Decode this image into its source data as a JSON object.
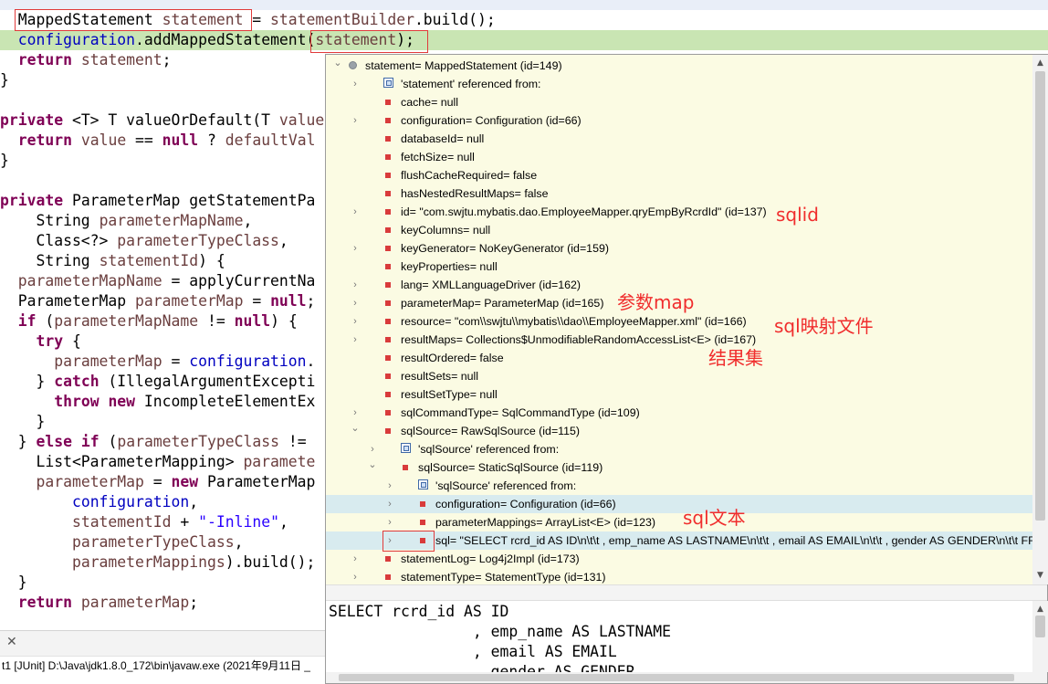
{
  "editor": {
    "lines": [
      [
        {
          "t": "  MappedStatement "
        },
        {
          "t": "statement",
          "c": "var"
        },
        {
          "t": " = "
        },
        {
          "t": "statementBuilder",
          "c": "var"
        },
        {
          "t": ".build();"
        }
      ],
      [
        {
          "t": "  "
        },
        {
          "t": "configuration",
          "c": "fld"
        },
        {
          "t": ".addMappedStatement("
        },
        {
          "t": "statement",
          "c": "var"
        },
        {
          "t": ");"
        }
      ],
      [
        {
          "t": "  "
        },
        {
          "t": "return",
          "c": "kw"
        },
        {
          "t": " "
        },
        {
          "t": "statement",
          "c": "var"
        },
        {
          "t": ";"
        }
      ],
      [
        {
          "t": "}"
        }
      ],
      [
        {
          "t": ""
        }
      ],
      [
        {
          "t": "private",
          "c": "kw"
        },
        {
          "t": " <T> T valueOrDefault(T "
        },
        {
          "t": "value",
          "c": "var"
        }
      ],
      [
        {
          "t": "  "
        },
        {
          "t": "return",
          "c": "kw"
        },
        {
          "t": " "
        },
        {
          "t": "value",
          "c": "var"
        },
        {
          "t": " == "
        },
        {
          "t": "null",
          "c": "kw"
        },
        {
          "t": " ? "
        },
        {
          "t": "defaultVal",
          "c": "var"
        }
      ],
      [
        {
          "t": "}"
        }
      ],
      [
        {
          "t": ""
        }
      ],
      [
        {
          "t": "private",
          "c": "kw"
        },
        {
          "t": " ParameterMap getStatementPa"
        }
      ],
      [
        {
          "t": "    String "
        },
        {
          "t": "parameterMapName",
          "c": "var"
        },
        {
          "t": ","
        }
      ],
      [
        {
          "t": "    Class<?> "
        },
        {
          "t": "parameterTypeClass",
          "c": "var"
        },
        {
          "t": ","
        }
      ],
      [
        {
          "t": "    String "
        },
        {
          "t": "statementId",
          "c": "var"
        },
        {
          "t": ") {"
        }
      ],
      [
        {
          "t": "  "
        },
        {
          "t": "parameterMapName",
          "c": "var"
        },
        {
          "t": " = applyCurrentNa"
        }
      ],
      [
        {
          "t": "  ParameterMap "
        },
        {
          "t": "parameterMap",
          "c": "var"
        },
        {
          "t": " = "
        },
        {
          "t": "null",
          "c": "kw"
        },
        {
          "t": ";"
        }
      ],
      [
        {
          "t": "  "
        },
        {
          "t": "if",
          "c": "kw"
        },
        {
          "t": " ("
        },
        {
          "t": "parameterMapName",
          "c": "var"
        },
        {
          "t": " != "
        },
        {
          "t": "null",
          "c": "kw"
        },
        {
          "t": ") {"
        }
      ],
      [
        {
          "t": "    "
        },
        {
          "t": "try",
          "c": "kw"
        },
        {
          "t": " {"
        }
      ],
      [
        {
          "t": "      "
        },
        {
          "t": "parameterMap",
          "c": "var"
        },
        {
          "t": " = "
        },
        {
          "t": "configuration",
          "c": "fld"
        },
        {
          "t": "."
        }
      ],
      [
        {
          "t": "    } "
        },
        {
          "t": "catch",
          "c": "kw"
        },
        {
          "t": " (IllegalArgumentExcepti"
        }
      ],
      [
        {
          "t": "      "
        },
        {
          "t": "throw",
          "c": "kw"
        },
        {
          "t": " "
        },
        {
          "t": "new",
          "c": "kw"
        },
        {
          "t": " IncompleteElementEx"
        }
      ],
      [
        {
          "t": "    }"
        }
      ],
      [
        {
          "t": "  } "
        },
        {
          "t": "else",
          "c": "kw"
        },
        {
          "t": " "
        },
        {
          "t": "if",
          "c": "kw"
        },
        {
          "t": " ("
        },
        {
          "t": "parameterTypeClass",
          "c": "var"
        },
        {
          "t": " != "
        }
      ],
      [
        {
          "t": "    List<ParameterMapping> "
        },
        {
          "t": "paramete",
          "c": "var"
        }
      ],
      [
        {
          "t": "    "
        },
        {
          "t": "parameterMap",
          "c": "var"
        },
        {
          "t": " = "
        },
        {
          "t": "new",
          "c": "kw"
        },
        {
          "t": " ParameterMap"
        }
      ],
      [
        {
          "t": "        "
        },
        {
          "t": "configuration",
          "c": "fld"
        },
        {
          "t": ","
        }
      ],
      [
        {
          "t": "        "
        },
        {
          "t": "statementId",
          "c": "var"
        },
        {
          "t": " + "
        },
        {
          "t": "\"-Inline\"",
          "c": "str"
        },
        {
          "t": ","
        }
      ],
      [
        {
          "t": "        "
        },
        {
          "t": "parameterTypeClass",
          "c": "var"
        },
        {
          "t": ","
        }
      ],
      [
        {
          "t": "        "
        },
        {
          "t": "parameterMappings",
          "c": "var"
        },
        {
          "t": ").build();"
        }
      ],
      [
        {
          "t": "  }"
        }
      ],
      [
        {
          "t": "  "
        },
        {
          "t": "return",
          "c": "kw"
        },
        {
          "t": " "
        },
        {
          "t": "parameterMap",
          "c": "var"
        },
        {
          "t": ";"
        }
      ]
    ]
  },
  "console": {
    "close_glyph": "✕",
    "line": "t1 [JUnit] D:\\Java\\jdk1.8.0_172\\bin\\javaw.exe (2021年9月11日 _"
  },
  "popup": {
    "rows": [
      {
        "d": 0,
        "tw": "open",
        "icon": "object",
        "text": "statement= MappedStatement  (id=149)"
      },
      {
        "d": 1,
        "tw": "closed",
        "icon": "ref",
        "text": "'statement' referenced from:"
      },
      {
        "d": 1,
        "tw": "none",
        "icon": "field",
        "text": "cache= null"
      },
      {
        "d": 1,
        "tw": "closed",
        "icon": "field",
        "text": "configuration= Configuration  (id=66)"
      },
      {
        "d": 1,
        "tw": "none",
        "icon": "field",
        "text": "databaseId= null"
      },
      {
        "d": 1,
        "tw": "none",
        "icon": "field",
        "text": "fetchSize= null"
      },
      {
        "d": 1,
        "tw": "none",
        "icon": "field",
        "text": "flushCacheRequired= false"
      },
      {
        "d": 1,
        "tw": "none",
        "icon": "field",
        "text": "hasNestedResultMaps= false"
      },
      {
        "d": 1,
        "tw": "closed",
        "icon": "field",
        "text": "id= \"com.swjtu.mybatis.dao.EmployeeMapper.qryEmpByRcrdId\" (id=137)"
      },
      {
        "d": 1,
        "tw": "none",
        "icon": "field",
        "text": "keyColumns= null"
      },
      {
        "d": 1,
        "tw": "closed",
        "icon": "field",
        "text": "keyGenerator= NoKeyGenerator  (id=159)"
      },
      {
        "d": 1,
        "tw": "none",
        "icon": "field",
        "text": "keyProperties= null"
      },
      {
        "d": 1,
        "tw": "closed",
        "icon": "field",
        "text": "lang= XMLLanguageDriver  (id=162)"
      },
      {
        "d": 1,
        "tw": "closed",
        "icon": "field",
        "text": "parameterMap= ParameterMap  (id=165)"
      },
      {
        "d": 1,
        "tw": "closed",
        "icon": "field",
        "text": "resource= \"com\\\\swjtu\\\\mybatis\\\\dao\\\\EmployeeMapper.xml\" (id=166)"
      },
      {
        "d": 1,
        "tw": "closed",
        "icon": "field",
        "text": "resultMaps= Collections$UnmodifiableRandomAccessList<E>  (id=167)"
      },
      {
        "d": 1,
        "tw": "none",
        "icon": "field",
        "text": "resultOrdered= false"
      },
      {
        "d": 1,
        "tw": "none",
        "icon": "field",
        "text": "resultSets= null"
      },
      {
        "d": 1,
        "tw": "none",
        "icon": "field",
        "text": "resultSetType= null"
      },
      {
        "d": 1,
        "tw": "closed",
        "icon": "field",
        "text": "sqlCommandType= SqlCommandType  (id=109)"
      },
      {
        "d": 1,
        "tw": "open",
        "icon": "field",
        "text": "sqlSource= RawSqlSource  (id=115)"
      },
      {
        "d": 2,
        "tw": "closed",
        "icon": "ref",
        "text": "'sqlSource' referenced from:"
      },
      {
        "d": 2,
        "tw": "open",
        "icon": "field",
        "text": "sqlSource= StaticSqlSource  (id=119)"
      },
      {
        "d": 3,
        "tw": "closed",
        "icon": "ref",
        "text": "'sqlSource' referenced from:"
      },
      {
        "d": 3,
        "tw": "closed",
        "icon": "field",
        "text": "configuration= Configuration  (id=66)",
        "sel": true
      },
      {
        "d": 3,
        "tw": "closed",
        "icon": "field",
        "text": "parameterMappings= ArrayList<E>  (id=123)"
      },
      {
        "d": 3,
        "tw": "closed",
        "icon": "field",
        "text": "sql= \"SELECT rcrd_id AS ID\\n\\t\\t        , emp_name AS LASTNAME\\n\\t\\t        , email AS EMAIL\\n\\t\\t        , gender AS GENDER\\n\\t\\t FROM tbl_employee\\n\\t\\t WHERE rcrd_id = ?\"",
        "sel": true
      },
      {
        "d": 1,
        "tw": "closed",
        "icon": "field",
        "text": "statementLog= Log4j2Impl  (id=173)"
      },
      {
        "d": 1,
        "tw": "closed",
        "icon": "field",
        "text": "statementType= StatementType  (id=131)"
      }
    ],
    "detail_lines": [
      "SELECT rcrd_id AS ID",
      "                , emp_name AS LASTNAME",
      "                , email AS EMAIL",
      "                , gender AS GENDER"
    ],
    "scroll_up_glyph": "▲",
    "scroll_down_glyph": "▼",
    "twisty_open_glyph": "⌄",
    "twisty_closed_glyph": "›"
  },
  "annotations": {
    "sqlid": "sqlid",
    "parameter_map": "参数map",
    "sql_mapping_file": "sql映射文件",
    "result_set": "结果集",
    "sql_text": "sql文本"
  },
  "annotation_color": "#f02d2d",
  "icons": {
    "field": "red-square-field-icon",
    "object": "object-instance-icon",
    "ref": "referenced-from-icon"
  }
}
